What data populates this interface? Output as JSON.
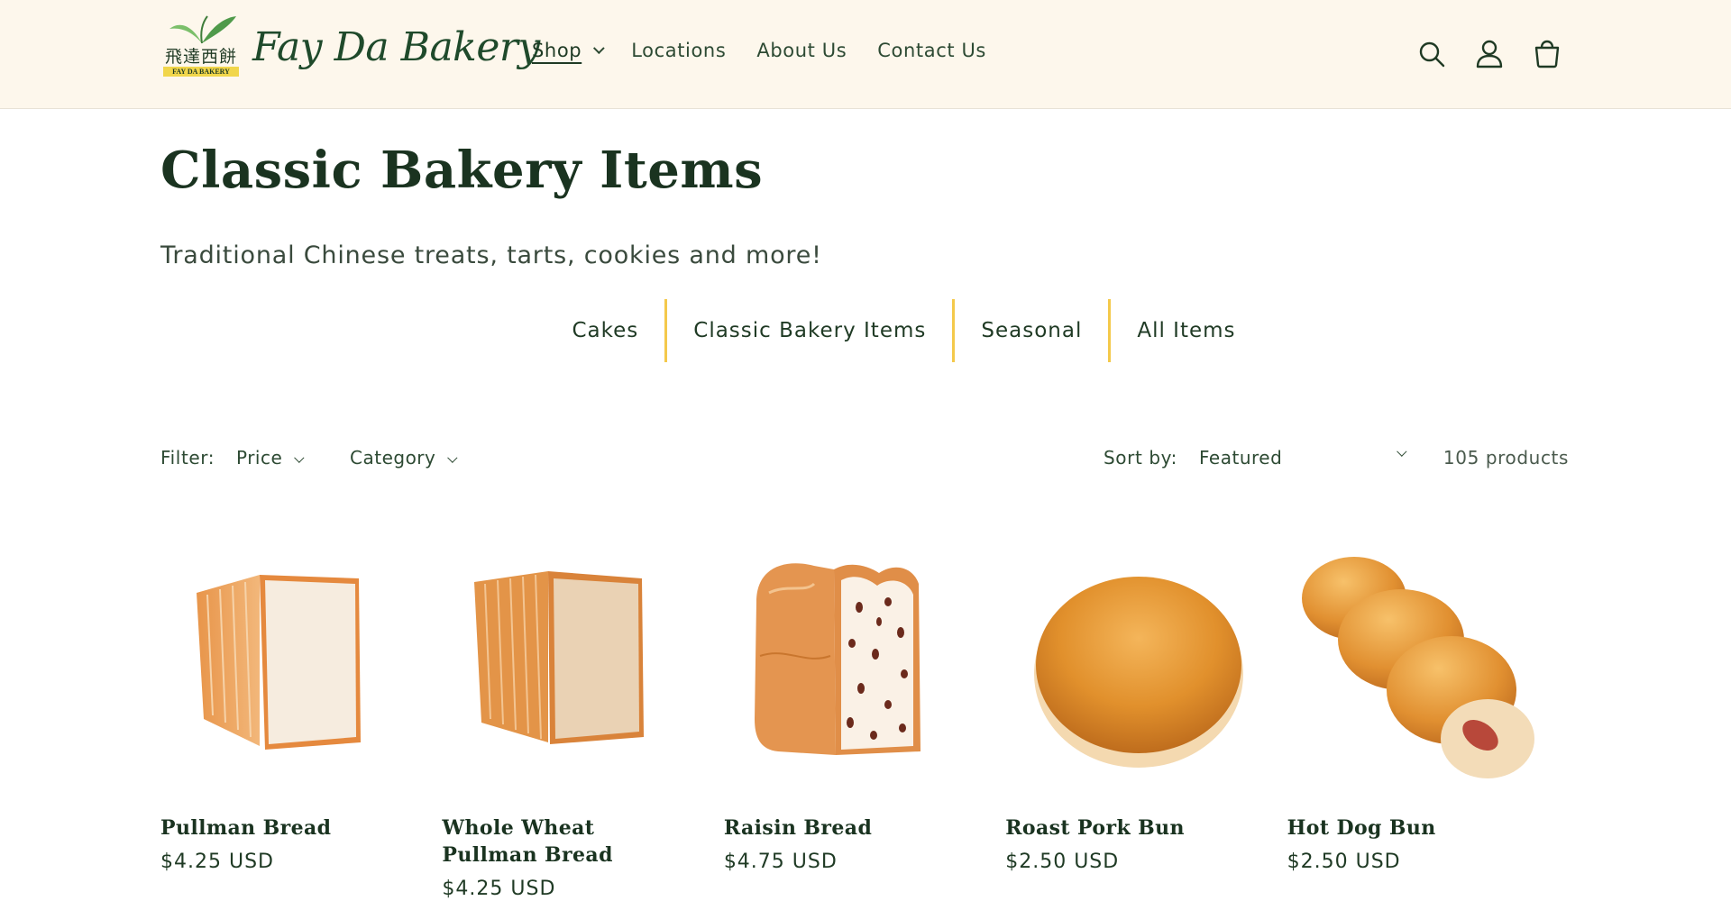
{
  "brand": {
    "chinese_name": "飛達西餅",
    "ribbon_text": "FAY DA BAKERY",
    "script_name": "Fay Da Bakery"
  },
  "nav": {
    "items": [
      {
        "label": "Shop",
        "has_dropdown": true,
        "active": true
      },
      {
        "label": "Locations"
      },
      {
        "label": "About Us"
      },
      {
        "label": "Contact Us"
      }
    ],
    "icons": [
      "search-icon",
      "account-icon",
      "cart-icon"
    ]
  },
  "page": {
    "title": "Classic Bakery Items",
    "subtitle": "Traditional Chinese treats, tarts, cookies and more!"
  },
  "category_tabs": [
    "Cakes",
    "Classic Bakery Items",
    "Seasonal",
    "All Items"
  ],
  "filters": {
    "label": "Filter:",
    "price": "Price",
    "category": "Category",
    "sort_label": "Sort by:",
    "sort_value": "Featured",
    "count": "105 products"
  },
  "products": [
    {
      "name": "Pullman Bread",
      "price": "$4.25 USD",
      "image": "white-loaf"
    },
    {
      "name": "Whole Wheat Pullman Bread",
      "price": "$4.25 USD",
      "image": "wheat-loaf"
    },
    {
      "name": "Raisin Bread",
      "price": "$4.75 USD",
      "image": "raisin-loaf"
    },
    {
      "name": "Roast Pork Bun",
      "price": "$2.50 USD",
      "image": "round-bun"
    },
    {
      "name": "Hot Dog Bun",
      "price": "$2.50 USD",
      "image": "hotdog-bun"
    }
  ],
  "colors": {
    "header_bg": "#fdf7ec",
    "accent_divider": "#f4c94b",
    "brand_green": "#1f4a2b"
  }
}
